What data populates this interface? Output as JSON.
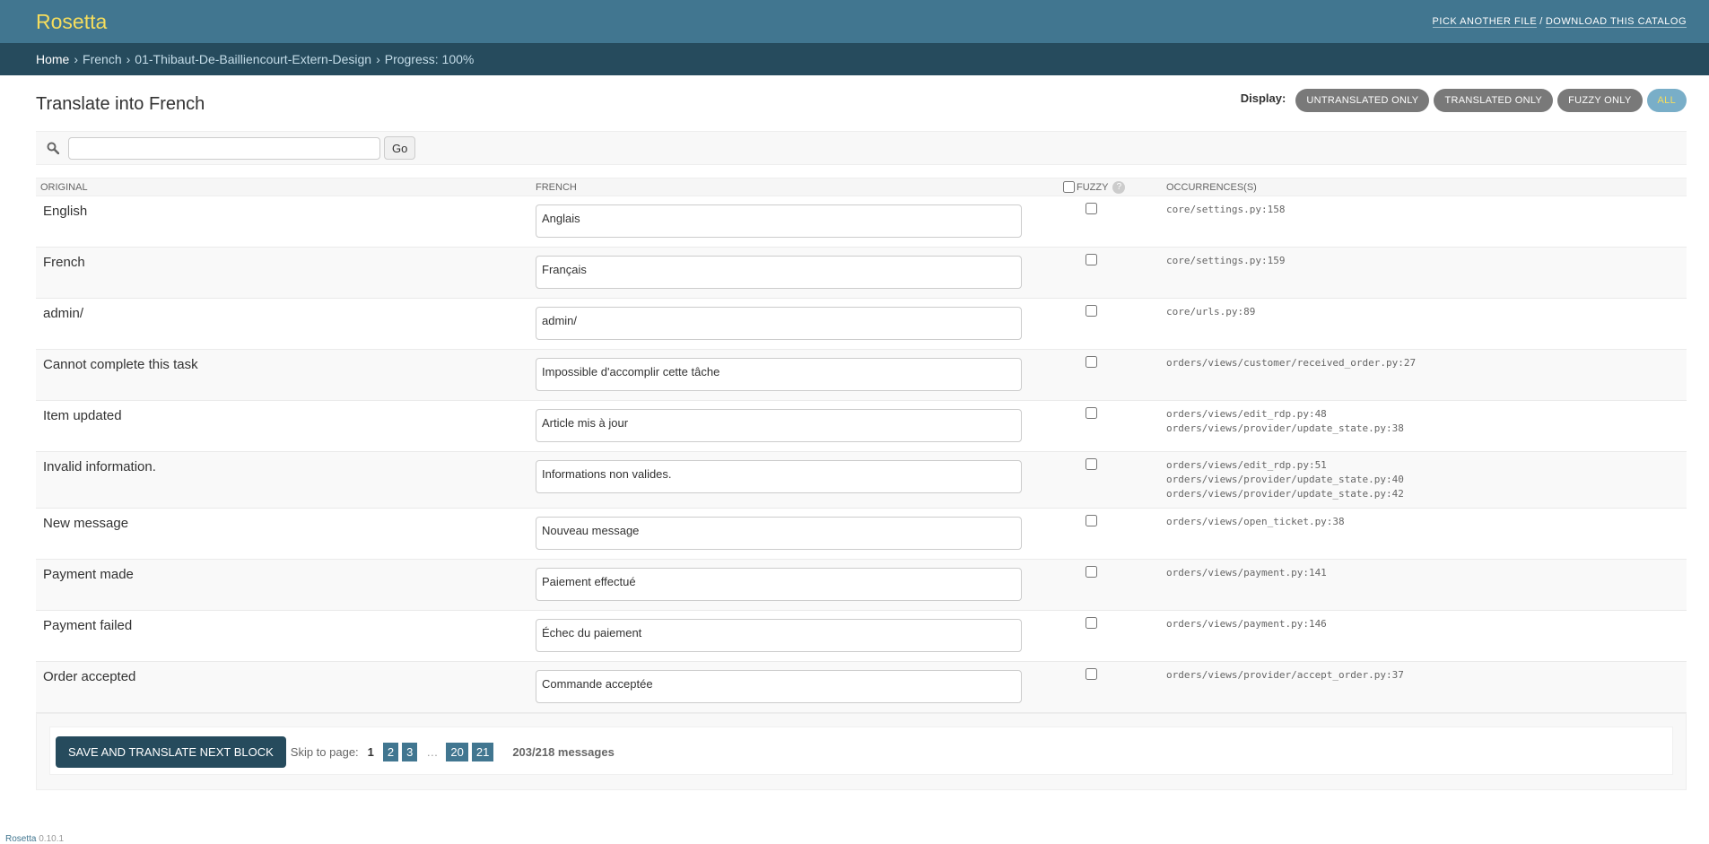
{
  "header": {
    "brand": "Rosetta",
    "pick_file": "PICK ANOTHER FILE",
    "separator": "/",
    "download": "DOWNLOAD THIS CATALOG"
  },
  "breadcrumbs": {
    "home": "Home",
    "language": "French",
    "catalog": "01-Thibaut-De-Bailliencourt-Extern-Design",
    "progress": "Progress: 100%"
  },
  "page": {
    "title": "Translate into French"
  },
  "display": {
    "label": "Display:",
    "filters": [
      "UNTRANSLATED ONLY",
      "TRANSLATED ONLY",
      "FUZZY ONLY",
      "ALL"
    ],
    "active": "ALL"
  },
  "search": {
    "value": "",
    "placeholder": "",
    "go": "Go"
  },
  "table": {
    "headers": {
      "original": "ORIGINAL",
      "translation": "FRENCH",
      "fuzzy": "FUZZY",
      "help": "?",
      "occurrences": "OCCURRENCES(S)"
    },
    "rows": [
      {
        "original": "English",
        "translation": "Anglais",
        "fuzzy": false,
        "occurrences": [
          "core/settings.py:158"
        ]
      },
      {
        "original": "French",
        "translation": "Français",
        "fuzzy": false,
        "occurrences": [
          "core/settings.py:159"
        ]
      },
      {
        "original": "admin/",
        "translation": "admin/",
        "fuzzy": false,
        "occurrences": [
          "core/urls.py:89"
        ]
      },
      {
        "original": "Cannot complete this task",
        "translation": "Impossible d'accomplir cette tâche",
        "fuzzy": false,
        "occurrences": [
          "orders/views/customer/received_order.py:27"
        ]
      },
      {
        "original": "Item updated",
        "translation": "Article mis à jour",
        "fuzzy": false,
        "occurrences": [
          "orders/views/edit_rdp.py:48",
          "orders/views/provider/update_state.py:38"
        ]
      },
      {
        "original": "Invalid information.",
        "translation": "Informations non valides.",
        "fuzzy": false,
        "occurrences": [
          "orders/views/edit_rdp.py:51",
          "orders/views/provider/update_state.py:40",
          "orders/views/provider/update_state.py:42"
        ]
      },
      {
        "original": "New message",
        "translation": "Nouveau message",
        "fuzzy": false,
        "occurrences": [
          "orders/views/open_ticket.py:38"
        ]
      },
      {
        "original": "Payment made",
        "translation": "Paiement effectué",
        "fuzzy": false,
        "occurrences": [
          "orders/views/payment.py:141"
        ]
      },
      {
        "original": "Payment failed",
        "translation": "Échec du paiement",
        "fuzzy": false,
        "occurrences": [
          "orders/views/payment.py:146"
        ]
      },
      {
        "original": "Order accepted",
        "translation": "Commande acceptée",
        "fuzzy": false,
        "occurrences": [
          "orders/views/provider/accept_order.py:37"
        ]
      }
    ]
  },
  "pagination": {
    "save": "SAVE AND TRANSLATE NEXT BLOCK",
    "skip_label": "Skip to page:",
    "current": "1",
    "pages_before": [
      "2",
      "3"
    ],
    "ellipsis": "…",
    "pages_after": [
      "20",
      "21"
    ],
    "messages": "203/218 messages"
  },
  "footer": {
    "brand": "Rosetta",
    "version": "0.10.1"
  },
  "colors": {
    "header": "#417690",
    "breadcrumbs": "#264b5d",
    "brand": "#f5dd5d",
    "filter_button": "#797979",
    "filter_active": "#79aec8",
    "save_button": "#264b5d",
    "page_link": "#417690"
  }
}
